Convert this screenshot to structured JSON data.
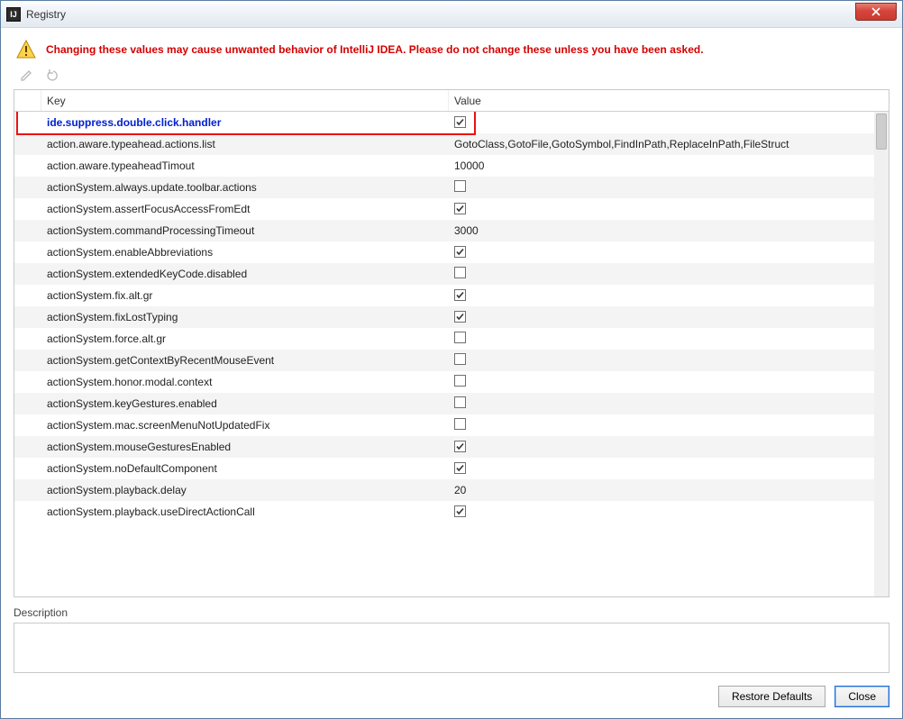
{
  "window": {
    "title": "Registry",
    "app_icon_text": "IJ"
  },
  "warning": {
    "text": "Changing these values may cause unwanted behavior of IntelliJ IDEA. Please do not change these unless you have been asked."
  },
  "toolbar": {
    "edit_icon": "edit-icon",
    "revert_icon": "revert-icon"
  },
  "table": {
    "headers": {
      "key": "Key",
      "value": "Value"
    },
    "rows": [
      {
        "key": "ide.suppress.double.click.handler",
        "type": "checkbox",
        "checked": true,
        "selected": true
      },
      {
        "key": "action.aware.typeahead.actions.list",
        "type": "text",
        "value": "GotoClass,GotoFile,GotoSymbol,FindInPath,ReplaceInPath,FileStruct"
      },
      {
        "key": "action.aware.typeaheadTimout",
        "type": "text",
        "value": "10000"
      },
      {
        "key": "actionSystem.always.update.toolbar.actions",
        "type": "checkbox",
        "checked": false
      },
      {
        "key": "actionSystem.assertFocusAccessFromEdt",
        "type": "checkbox",
        "checked": true
      },
      {
        "key": "actionSystem.commandProcessingTimeout",
        "type": "text",
        "value": "3000"
      },
      {
        "key": "actionSystem.enableAbbreviations",
        "type": "checkbox",
        "checked": true
      },
      {
        "key": "actionSystem.extendedKeyCode.disabled",
        "type": "checkbox",
        "checked": false
      },
      {
        "key": "actionSystem.fix.alt.gr",
        "type": "checkbox",
        "checked": true
      },
      {
        "key": "actionSystem.fixLostTyping",
        "type": "checkbox",
        "checked": true
      },
      {
        "key": "actionSystem.force.alt.gr",
        "type": "checkbox",
        "checked": false
      },
      {
        "key": "actionSystem.getContextByRecentMouseEvent",
        "type": "checkbox",
        "checked": false
      },
      {
        "key": "actionSystem.honor.modal.context",
        "type": "checkbox",
        "checked": false
      },
      {
        "key": "actionSystem.keyGestures.enabled",
        "type": "checkbox",
        "checked": false
      },
      {
        "key": "actionSystem.mac.screenMenuNotUpdatedFix",
        "type": "checkbox",
        "checked": false
      },
      {
        "key": "actionSystem.mouseGesturesEnabled",
        "type": "checkbox",
        "checked": true
      },
      {
        "key": "actionSystem.noDefaultComponent",
        "type": "checkbox",
        "checked": true
      },
      {
        "key": "actionSystem.playback.delay",
        "type": "text",
        "value": "20"
      },
      {
        "key": "actionSystem.playback.useDirectActionCall",
        "type": "checkbox",
        "checked": true
      }
    ]
  },
  "description": {
    "label": "Description",
    "text": ""
  },
  "footer": {
    "restore_label": "Restore Defaults",
    "close_label": "Close"
  }
}
